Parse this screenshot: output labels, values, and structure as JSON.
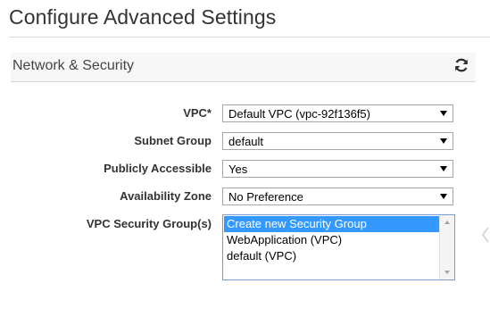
{
  "page": {
    "title": "Configure Advanced Settings"
  },
  "section": {
    "title": "Network & Security",
    "refresh_icon": "refresh-icon"
  },
  "form": {
    "vpc": {
      "label": "VPC*",
      "value": "Default VPC (vpc-92f136f5)"
    },
    "subnet_group": {
      "label": "Subnet Group",
      "value": "default"
    },
    "publicly_accessible": {
      "label": "Publicly Accessible",
      "value": "Yes"
    },
    "availability_zone": {
      "label": "Availability Zone",
      "value": "No Preference"
    },
    "security_groups": {
      "label": "VPC Security Group(s)",
      "options": [
        "Create new Security Group",
        "WebApplication (VPC)",
        "default (VPC)"
      ],
      "selected": "Create new Security Group"
    }
  },
  "colors": {
    "selected_option_bg": "#3399ff",
    "refresh_icon": "#2d2d2d"
  }
}
